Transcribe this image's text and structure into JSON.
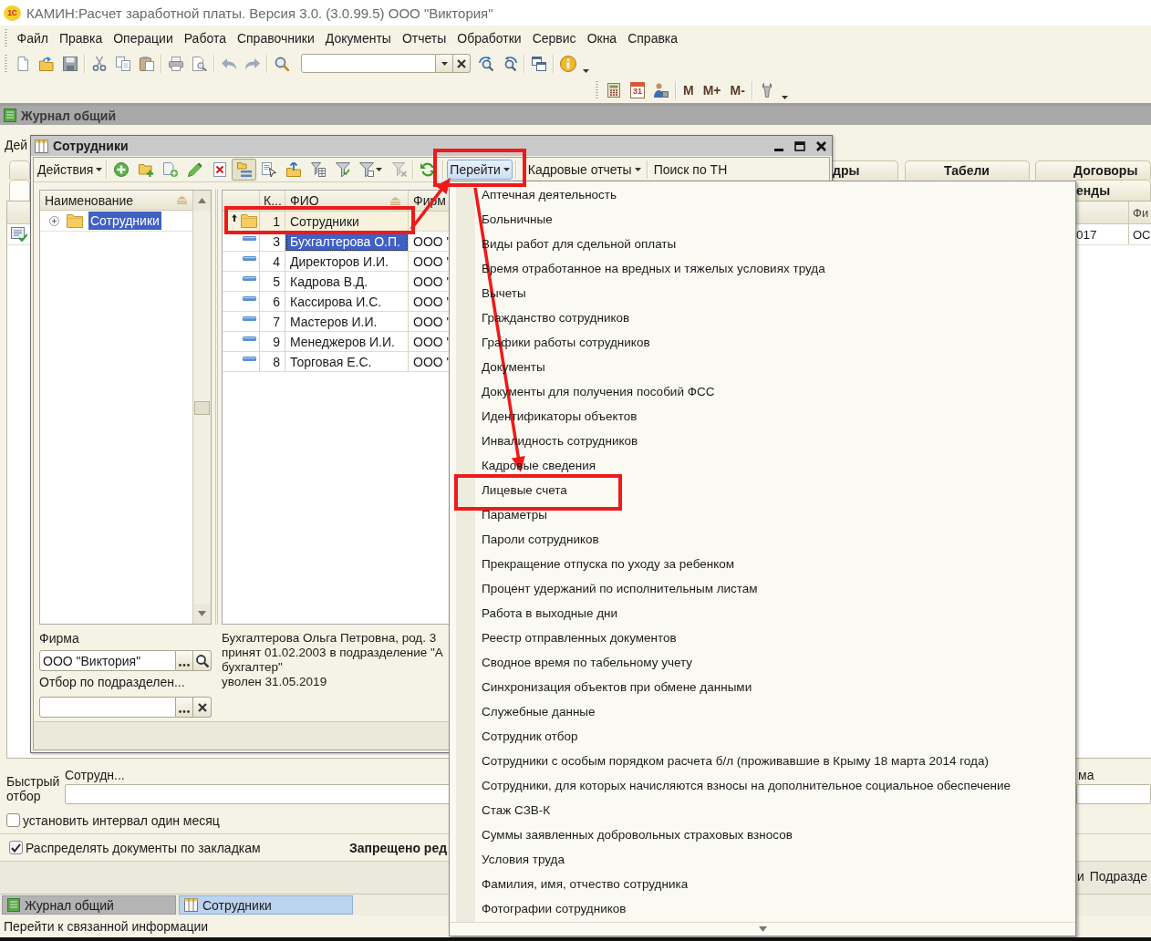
{
  "window": {
    "logo": "1С",
    "title": "КАМИН:Расчет заработной платы. Версия 3.0. (3.0.99.5) ООО \"Виктория\""
  },
  "menu_bar": [
    "Файл",
    "Правка",
    "Операции",
    "Работа",
    "Справочники",
    "Документы",
    "Отчеты",
    "Обработки",
    "Сервис",
    "Окна",
    "Справка"
  ],
  "toolbar_2": {
    "calendar_day": "31",
    "memory_buttons": [
      "M",
      "M+",
      "M-"
    ]
  },
  "journal": {
    "title": "Журнал общий",
    "actions_menu": "Дей",
    "tabs": [
      {
        "selected": false
      },
      {
        "label": "дры",
        "selected": false
      },
      {
        "label": "Табели",
        "selected": false
      },
      {
        "label": "Договоры",
        "selected": false
      }
    ],
    "subtabs": [
      {
        "selected": true
      },
      {
        "label": "енды",
        "selected": false
      }
    ],
    "table": {
      "columns": [
        "",
        "Фи"
      ],
      "rows": [
        {
          "cells": [
            "017",
            "ОС"
          ]
        }
      ]
    },
    "quick_filter": {
      "label": "Быстрый отбор",
      "fields": [
        {
          "label": "Сотрудн..."
        },
        {
          "label": "ма"
        }
      ]
    },
    "options": [
      {
        "label": "установить интервал один месяц",
        "checked": false
      },
      {
        "label": "Распределять документы по закладкам",
        "checked": true
      }
    ],
    "warning": "Запрещено ред",
    "footer_texts": [
      "и",
      "Подразде"
    ]
  },
  "employees_window": {
    "title": "Сотрудники",
    "toolbar": {
      "actions_menu": "Действия",
      "tool_buttons": [
        {
          "pressed": false
        },
        {
          "pressed": false
        },
        {
          "pressed": false
        },
        {
          "pressed": false
        },
        {
          "pressed": false
        },
        {
          "pressed": true
        },
        {
          "pressed": false
        },
        {
          "pressed": false
        },
        {
          "pressed": false
        },
        {
          "pressed": false
        },
        {
          "pressed": false
        },
        {
          "pressed": false
        },
        {
          "pressed": false
        }
      ],
      "menus": [
        {
          "kind": "dropdown",
          "label": "Перейти",
          "expanded": true
        },
        {
          "kind": "dropdown",
          "label": "Кадровые отчеты",
          "expanded": false
        },
        {
          "kind": "button",
          "label": "Поиск по ТН",
          "expanded": false
        }
      ]
    },
    "tree": {
      "header": "Наименование",
      "items": [
        {
          "label": "Сотрудники",
          "expanded": false,
          "selected": true
        }
      ]
    },
    "table": {
      "columns": [
        "К...",
        "ФИО",
        "Фирм"
      ],
      "rows": [
        {
          "kind": "group",
          "code": "1",
          "name": "Сотрудники",
          "selected": false
        },
        {
          "kind": "item",
          "code": "3",
          "name": "Бухгалтерова О.П.",
          "firm": "ООО \"",
          "selected": true
        },
        {
          "kind": "item",
          "code": "4",
          "name": "Директоров И.И.",
          "firm": "ООО \"",
          "selected": false
        },
        {
          "kind": "item",
          "code": "5",
          "name": "Кадрова В.Д.",
          "firm": "ООО \"",
          "selected": false
        },
        {
          "kind": "item",
          "code": "6",
          "name": "Кассирова И.С.",
          "firm": "ООО \"",
          "selected": false
        },
        {
          "kind": "item",
          "code": "7",
          "name": "Мастеров И.И.",
          "firm": "ООО \"",
          "selected": false
        },
        {
          "kind": "item",
          "code": "9",
          "name": "Менеджеров И.И.",
          "firm": "ООО \"",
          "selected": false
        },
        {
          "kind": "item",
          "code": "8",
          "name": "Торговая Е.С.",
          "firm": "ООО \"",
          "selected": false
        }
      ]
    },
    "firm": {
      "label": "Фирма",
      "value": "ООО \"Виктория\""
    },
    "department_filter": {
      "label": "Отбор по подразделен..."
    },
    "details": "Бухгалтерова Ольга Петровна, род. 3\nпринят 01.02.2003 в подразделение \"А\nбухгалтер\"\nуволен 31.05.2019"
  },
  "goto_menu": {
    "items": [
      "Аптечная деятельность",
      "Больничные",
      "Виды работ для сдельной оплаты",
      "Время отработанное на вредных и тяжелых условиях труда",
      "Вычеты",
      "Гражданство сотрудников",
      "Графики работы сотрудников",
      "Документы",
      "Документы для получения пособий ФСС",
      "Идентификаторы объектов",
      "Инвалидность сотрудников",
      "Кадровые сведения",
      "Лицевые счета",
      "Параметры",
      "Пароли сотрудников",
      "Прекращение отпуска по уходу за ребенком",
      "Процент удержаний по исполнительным листам",
      "Работа в выходные дни",
      "Реестр отправленных документов",
      "Сводное время по табельному учету",
      "Синхронизация объектов при обмене данными",
      "Служебные данные",
      "Сотрудник отбор",
      "Сотрудники с особым порядком расчета б/л (проживавшие в Крыму 18 марта 2014 года)",
      "Сотрудники, для которых начисляются взносы на дополнительное социальное обеспечение",
      "Стаж СЗВ-К",
      "Суммы заявленных добровольных страховых взносов",
      "Условия труда",
      "Фамилия, имя, отчество сотрудника",
      "Фотографии сотрудников"
    ]
  },
  "window_bar": [
    {
      "label": "Журнал общий",
      "selected": false
    },
    {
      "label": "Сотрудники",
      "selected": true
    }
  ],
  "status_bar": {
    "text": "Перейти к связанной информации"
  },
  "annotations": [
    {
      "kind": "frame"
    },
    {
      "kind": "frame"
    },
    {
      "kind": "frame"
    },
    {
      "kind": "arrow"
    },
    {
      "kind": "arrow"
    }
  ]
}
